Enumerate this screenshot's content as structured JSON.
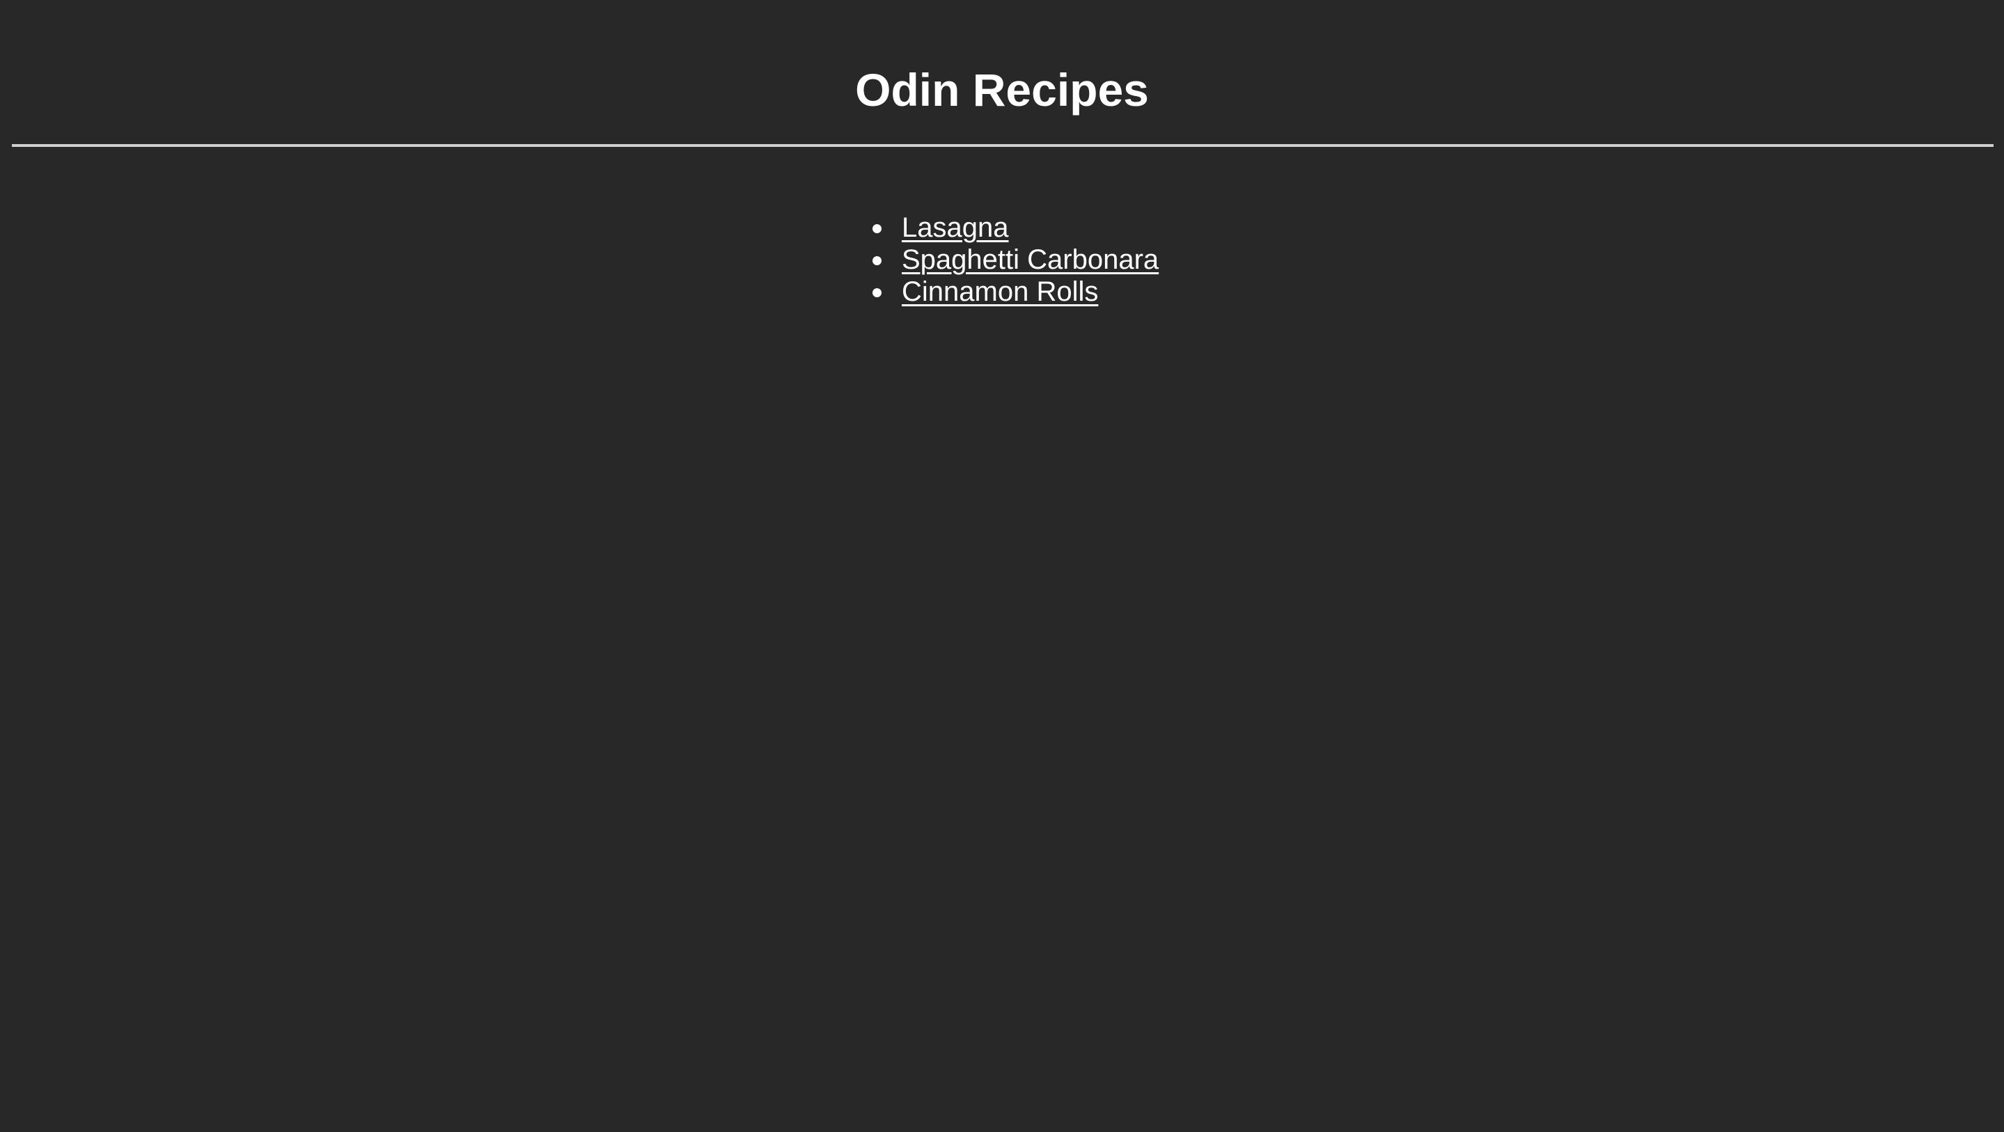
{
  "page": {
    "title": "Odin Recipes",
    "background_color": "#282828",
    "text_color": "#ffffff",
    "divider_color": "#d0d0d0"
  },
  "recipes": [
    {
      "label": "Lasagna"
    },
    {
      "label": "Spaghetti Carbonara"
    },
    {
      "label": "Cinnamon Rolls"
    }
  ]
}
